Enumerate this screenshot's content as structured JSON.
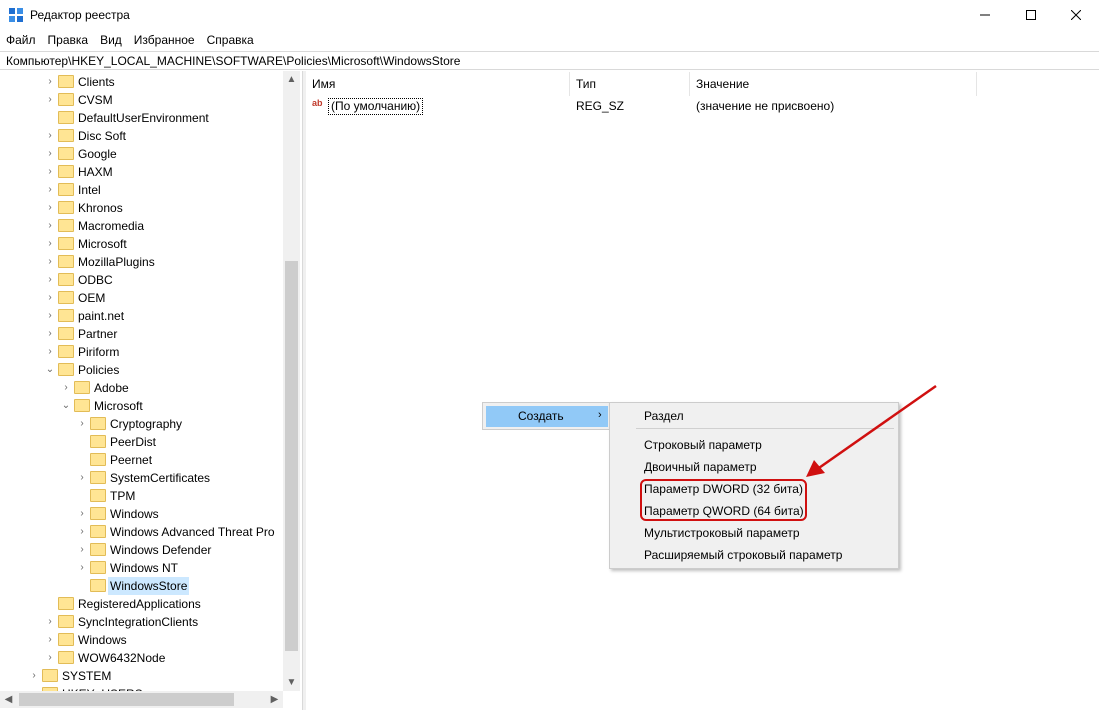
{
  "window": {
    "title": "Редактор реестра",
    "minimize_icon": "minimize-icon",
    "maximize_icon": "maximize-icon",
    "close_icon": "close-icon"
  },
  "menu": [
    "Файл",
    "Правка",
    "Вид",
    "Избранное",
    "Справка"
  ],
  "address": "Компьютер\\HKEY_LOCAL_MACHINE\\SOFTWARE\\Policies\\Microsoft\\WindowsStore",
  "tree": {
    "items": [
      {
        "label": "Clients",
        "expander": ">"
      },
      {
        "label": "CVSM",
        "expander": ">"
      },
      {
        "label": "DefaultUserEnvironment",
        "expander": ""
      },
      {
        "label": "Disc Soft",
        "expander": ">"
      },
      {
        "label": "Google",
        "expander": ">"
      },
      {
        "label": "HAXM",
        "expander": ">"
      },
      {
        "label": "Intel",
        "expander": ">"
      },
      {
        "label": "Khronos",
        "expander": ">"
      },
      {
        "label": "Macromedia",
        "expander": ">"
      },
      {
        "label": "Microsoft",
        "expander": ">"
      },
      {
        "label": "MozillaPlugins",
        "expander": ">"
      },
      {
        "label": "ODBC",
        "expander": ">"
      },
      {
        "label": "OEM",
        "expander": ">"
      },
      {
        "label": "paint.net",
        "expander": ">"
      },
      {
        "label": "Partner",
        "expander": ">"
      },
      {
        "label": "Piriform",
        "expander": ">"
      },
      {
        "label": "Policies",
        "expander": "v"
      },
      {
        "label": "Adobe",
        "expander": ">"
      },
      {
        "label": "Microsoft",
        "expander": "v"
      },
      {
        "label": "Cryptography",
        "expander": ">"
      },
      {
        "label": "PeerDist",
        "expander": ""
      },
      {
        "label": "Peernet",
        "expander": ""
      },
      {
        "label": "SystemCertificates",
        "expander": ">"
      },
      {
        "label": "TPM",
        "expander": ""
      },
      {
        "label": "Windows",
        "expander": ">"
      },
      {
        "label": "Windows Advanced Threat Pro",
        "expander": ">"
      },
      {
        "label": "Windows Defender",
        "expander": ">"
      },
      {
        "label": "Windows NT",
        "expander": ">"
      },
      {
        "label": "WindowsStore",
        "expander": "",
        "selected": true
      },
      {
        "label": "RegisteredApplications",
        "expander": ""
      },
      {
        "label": "SyncIntegrationClients",
        "expander": ">"
      },
      {
        "label": "Windows",
        "expander": ">"
      },
      {
        "label": "WOW6432Node",
        "expander": ">"
      },
      {
        "label": "SYSTEM",
        "expander": ">"
      },
      {
        "label": "HKEY_USERS",
        "expander": ">"
      }
    ]
  },
  "list": {
    "columns": [
      "Имя",
      "Тип",
      "Значение"
    ],
    "rows": [
      {
        "name": "(По умолчанию)",
        "icon": "ab",
        "type": "REG_SZ",
        "value": "(значение не присвоено)"
      }
    ]
  },
  "context_menu": {
    "parent_item": "Создать",
    "submenu": [
      "Раздел",
      "Строковый параметр",
      "Двоичный параметр",
      "Параметр DWORD (32 бита)",
      "Параметр QWORD (64 бита)",
      "Мультистроковый параметр",
      "Расширяемый строковый параметр"
    ]
  },
  "colors": {
    "highlight": "#d01010",
    "menu_hover": "#91c9f7",
    "folder": "#ffe594"
  }
}
